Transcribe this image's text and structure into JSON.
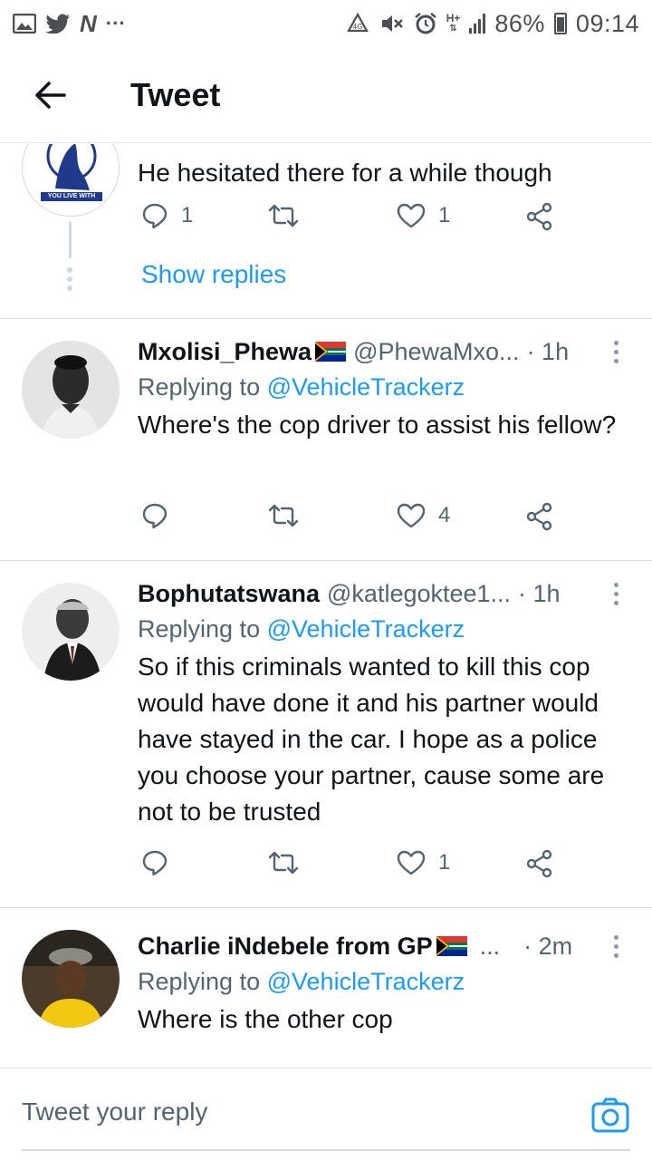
{
  "status_bar": {
    "left_icons": [
      "gallery-icon",
      "twitter-icon",
      "n-icon",
      "more-icon"
    ],
    "right_icons": [
      "recycle-icon",
      "mute-icon",
      "alarm-icon",
      "network-hplus-icon",
      "signal-icon"
    ],
    "battery": "86%",
    "time": "09:14",
    "network": "H+"
  },
  "header": {
    "title": "Tweet"
  },
  "tweets": [
    {
      "text": "He hesitated there for a while though",
      "reply_count": "1",
      "like_count": "1",
      "avatar_text": "YOU LIVE WITH",
      "show_replies": "Show replies"
    },
    {
      "name": "Mxolisi_Phewa",
      "handle": "@PhewaMxo...",
      "time": "· 1h",
      "replying_prefix": "Replying to",
      "replying_to": "@VehicleTrackerz",
      "text": "Where's the cop driver to assist his fellow?",
      "like_count": "4"
    },
    {
      "name": "Bophutatswana",
      "handle": "@katlegoktee1...",
      "time": "· 1h",
      "replying_prefix": "Replying to",
      "replying_to": "@VehicleTrackerz",
      "text": "So if this criminals wanted to kill this cop would have done it and his partner would have stayed in the car. I hope as a police you choose your partner, cause some are not to be trusted",
      "like_count": "1"
    },
    {
      "name": "Charlie iNdebele from GP",
      "handle": "...",
      "time": "· 2m",
      "replying_prefix": "Replying to",
      "replying_to": "@VehicleTrackerz",
      "text": "Where is the other cop"
    }
  ],
  "reply_box": {
    "placeholder": "Tweet your reply"
  },
  "colors": {
    "accent": "#1d9bf0",
    "secondary_text": "#536471",
    "primary_text": "#0f1419",
    "divider": "#d8dde1"
  }
}
